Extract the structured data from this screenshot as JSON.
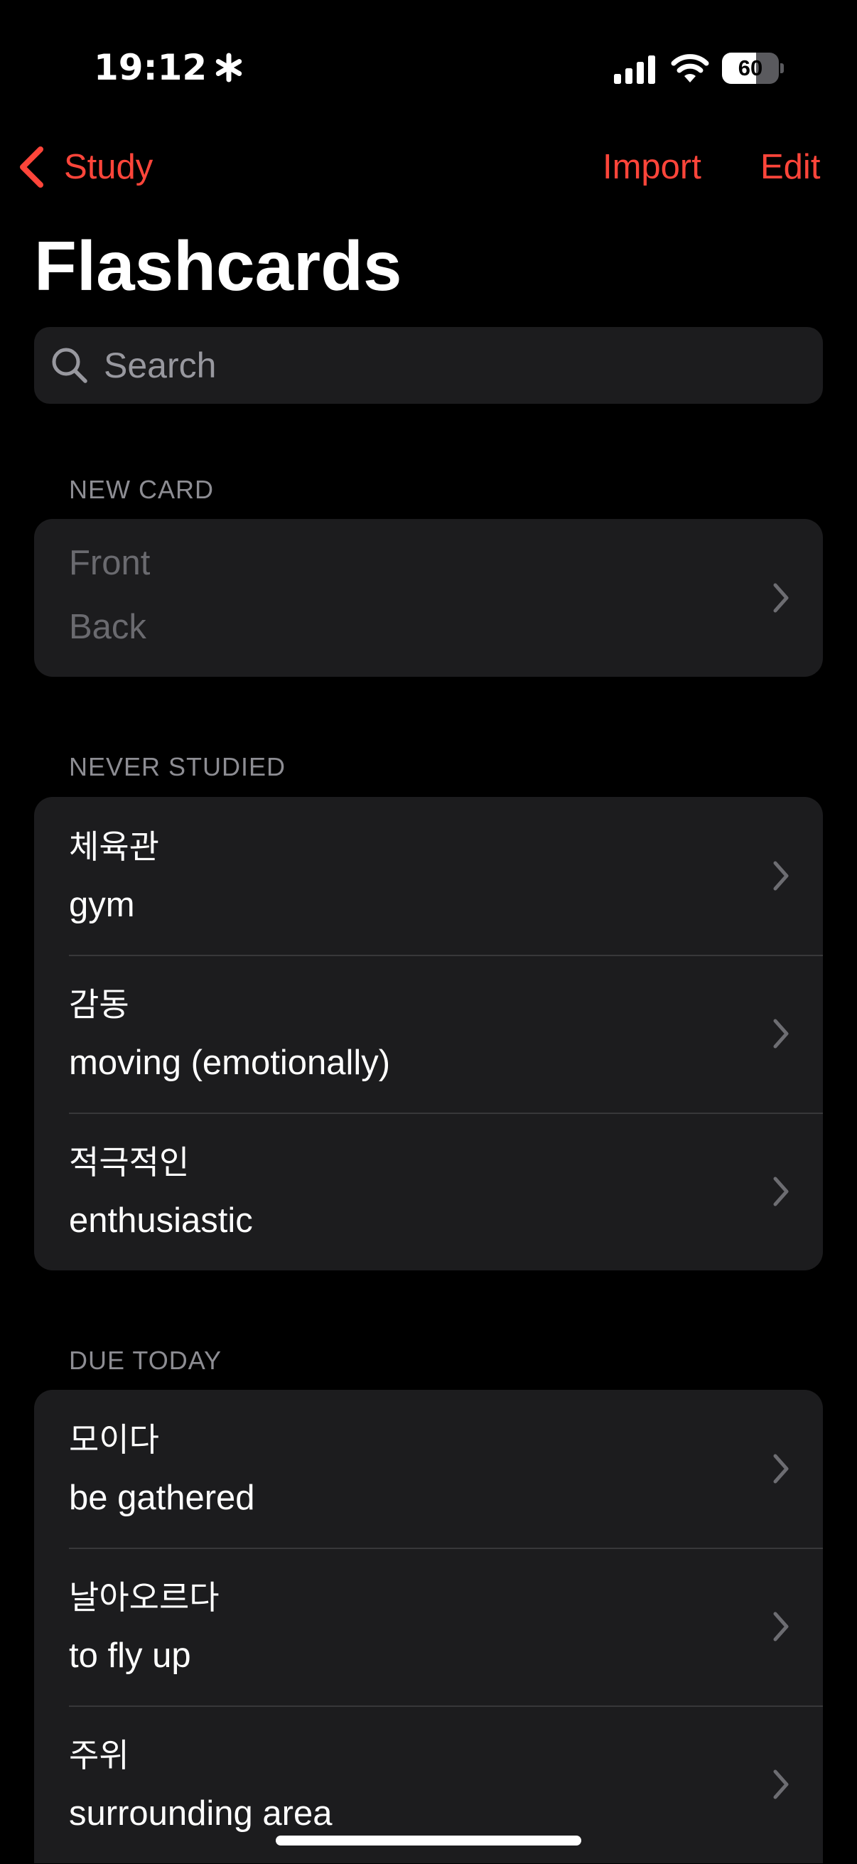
{
  "status_bar": {
    "time": "19:12",
    "battery_level": "60",
    "battery_fraction": 0.6,
    "icons": [
      "asterisk-icon",
      "signal-icon",
      "wifi-icon",
      "battery-icon"
    ]
  },
  "nav": {
    "back_label": "Study",
    "import_label": "Import",
    "edit_label": "Edit",
    "accent_color": "#ff453a"
  },
  "page_title": "Flashcards",
  "search": {
    "placeholder": "Search",
    "value": ""
  },
  "sections": {
    "new_card": {
      "header": "NEW CARD",
      "front_placeholder": "Front",
      "back_placeholder": "Back"
    },
    "never_studied": {
      "header": "NEVER STUDIED",
      "cards": [
        {
          "front": "체육관",
          "back": "gym"
        },
        {
          "front": "감동",
          "back": "moving (emotionally)"
        },
        {
          "front": "적극적인",
          "back": "enthusiastic"
        }
      ]
    },
    "due_today": {
      "header": "DUE TODAY",
      "cards": [
        {
          "front": "모이다",
          "back": "be gathered"
        },
        {
          "front": "날아오르다",
          "back": "to fly up"
        },
        {
          "front": "주위",
          "back": "surrounding area"
        }
      ]
    }
  }
}
